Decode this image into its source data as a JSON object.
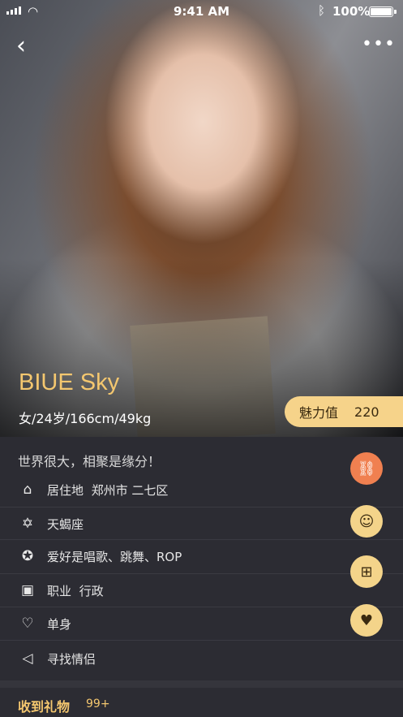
{
  "status_bar": {
    "time": "9:41 AM",
    "battery": "100%"
  },
  "profile": {
    "name": "BIUE Sky",
    "info": "女/24岁/166cm/49kg",
    "charm_label": "魅力值",
    "charm_value": "220",
    "motto": "世界很大，相聚是缘分！"
  },
  "details": [
    {
      "icon": "home-icon",
      "label": "居住地",
      "value": "郑州市 二七区"
    },
    {
      "icon": "star-of-david-icon",
      "label": "天蝎座",
      "value": ""
    },
    {
      "icon": "star-circle-icon",
      "label": "爱好是唱歌、跳舞、ROP",
      "value": ""
    },
    {
      "icon": "id-card-icon",
      "label": "职业",
      "value": "行政"
    },
    {
      "icon": "heart-icon",
      "label": "单身",
      "value": ""
    },
    {
      "icon": "speaker-icon",
      "label": "寻找情侣",
      "value": ""
    }
  ],
  "actions": [
    "link-icon",
    "chat-icon",
    "gift-icon",
    "heart-filled-icon"
  ],
  "gifts": {
    "title": "收到礼物",
    "count": "99+"
  },
  "colors": {
    "accent": "#f4c76f",
    "charm_bg": "#f6d38a",
    "fab_primary": "#f08050",
    "panel_bg": "#2c2c33"
  }
}
